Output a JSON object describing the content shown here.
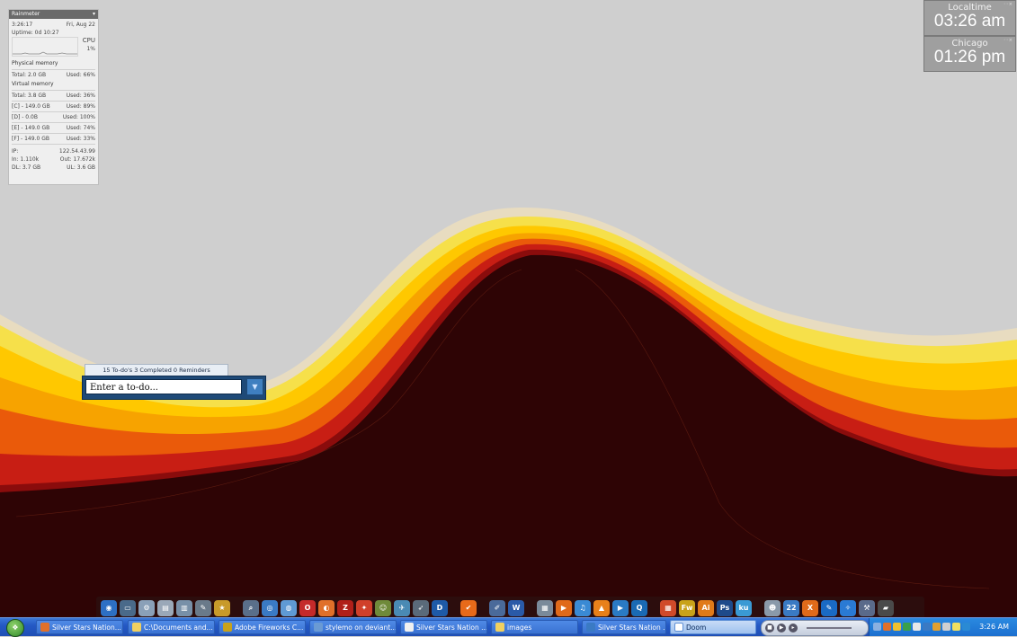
{
  "rainmeter": {
    "title": "Rainmeter",
    "time": "3:26:17",
    "date": "Fri, Aug 22",
    "uptime": "Uptime: 0d 10:27",
    "cpu_label": "CPU",
    "cpu_value": "1%",
    "physical_memory_label": "Physical memory",
    "physical_total": "Total: 2.0 GB",
    "physical_used": "Used: 66%",
    "virtual_memory_label": "Virtual memory",
    "virtual_total": "Total: 3.8 GB",
    "virtual_used": "Used: 36%",
    "drives": [
      {
        "label": "[C] - 149.0 GB",
        "used": "Used: 89%"
      },
      {
        "label": "[D] - 0.0B",
        "used": "Used: 100%"
      },
      {
        "label": "[E] - 149.0 GB",
        "used": "Used: 74%"
      },
      {
        "label": "[F] - 149.0 GB",
        "used": "Used: 33%"
      }
    ],
    "ip_label": "IP:",
    "ip_value": "122.54.43.99",
    "in_value": "In: 1.110k",
    "out_value": "Out: 17.672k",
    "dl_value": "DL: 3.7 GB",
    "ul_value": "UL: 3.6 GB"
  },
  "clocks": [
    {
      "city": "Localtime",
      "time": "03:26 am"
    },
    {
      "city": "Chicago",
      "time": "01:26 pm"
    }
  ],
  "todo": {
    "summary": "15 To-do's 3 Completed 0 Reminders",
    "placeholder": "Enter a to-do..."
  },
  "dock": {
    "icons": [
      {
        "name": "system-icon",
        "color": "#2d6fc4",
        "glyph": "◉"
      },
      {
        "name": "monitor-icon",
        "color": "#4a6a8a",
        "glyph": "▭"
      },
      {
        "name": "tools-icon",
        "color": "#8aa0b8",
        "glyph": "⚙"
      },
      {
        "name": "documents-icon",
        "color": "#9aa8b8",
        "glyph": "▤"
      },
      {
        "name": "folder-icon",
        "color": "#7890a8",
        "glyph": "▥"
      },
      {
        "name": "pen-icon",
        "color": "#6a7a8a",
        "glyph": "✎"
      },
      {
        "name": "star-icon",
        "color": "#c89a2a",
        "glyph": "★"
      },
      {
        "name": "search-icon",
        "color": "#5a6f8a",
        "glyph": "⌕"
      },
      {
        "name": "browser-icon",
        "color": "#3a7ac4",
        "glyph": "◎"
      },
      {
        "name": "globe-icon",
        "color": "#5f9ad4",
        "glyph": "◍"
      },
      {
        "name": "opera-icon",
        "color": "#c42a2a",
        "glyph": "O"
      },
      {
        "name": "firefox-icon",
        "color": "#e0702a",
        "glyph": "◐"
      },
      {
        "name": "filezilla-icon",
        "color": "#b0201a",
        "glyph": "Z"
      },
      {
        "name": "game-icon",
        "color": "#d0402a",
        "glyph": "✦"
      },
      {
        "name": "mascot-icon",
        "color": "#6f8a3a",
        "glyph": "☺"
      },
      {
        "name": "bird-icon",
        "color": "#4a8ab4",
        "glyph": "✈"
      },
      {
        "name": "wing-icon",
        "color": "#5a6a7a",
        "glyph": "➶"
      },
      {
        "name": "d-app-icon",
        "color": "#1e5aa8",
        "glyph": "D"
      },
      {
        "name": "check-icon",
        "color": "#e86a1a",
        "glyph": "✔"
      },
      {
        "name": "pencil-ruler-icon",
        "color": "#4a6a9a",
        "glyph": "✐"
      },
      {
        "name": "word-icon",
        "color": "#2a5aa8",
        "glyph": "W"
      },
      {
        "name": "book-icon",
        "color": "#7a8a9a",
        "glyph": "▦"
      },
      {
        "name": "media-icon",
        "color": "#e06a1a",
        "glyph": "▶"
      },
      {
        "name": "itunes-icon",
        "color": "#3a8ad4",
        "glyph": "♫"
      },
      {
        "name": "vlc-icon",
        "color": "#e8801a",
        "glyph": "▲"
      },
      {
        "name": "play-icon",
        "color": "#2a7ac4",
        "glyph": "▶"
      },
      {
        "name": "quicktime-icon",
        "color": "#1a6ab4",
        "glyph": "Q"
      },
      {
        "name": "office-icon",
        "color": "#d04a2a",
        "glyph": "▦"
      },
      {
        "name": "fireworks-icon",
        "color": "#c8a21a",
        "glyph": "Fw"
      },
      {
        "name": "illustrator-icon",
        "color": "#e07a1a",
        "glyph": "Ai"
      },
      {
        "name": "photoshop-icon",
        "color": "#1e4a8a",
        "glyph": "Ps"
      },
      {
        "name": "kuler-icon",
        "color": "#3a9ad4",
        "glyph": "ku"
      },
      {
        "name": "alien-icon",
        "color": "#8a9aaa",
        "glyph": "☻"
      },
      {
        "name": "calendar-icon",
        "color": "#3a7ac4",
        "glyph": "22"
      },
      {
        "name": "xampp-icon",
        "color": "#e06a1a",
        "glyph": "X"
      },
      {
        "name": "wrench-icon",
        "color": "#1a6ac4",
        "glyph": "✎"
      },
      {
        "name": "settings-icon",
        "color": "#2a7ad4",
        "glyph": "✧"
      },
      {
        "name": "tools2-icon",
        "color": "#5a6a8a",
        "glyph": "⚒"
      },
      {
        "name": "drive-icon",
        "color": "#4a4a4a",
        "glyph": "▰"
      }
    ]
  },
  "taskbar": {
    "tasks": [
      {
        "label": "Silver Stars Nation...",
        "color": "#e0702a"
      },
      {
        "label": "C:\\Documents and...",
        "color": "#f0d060"
      },
      {
        "label": "Adobe Fireworks C...",
        "color": "#c8a21a"
      },
      {
        "label": "stylemo on deviant...",
        "color": "#6a9ad4"
      },
      {
        "label": "Silver Stars Nation ...",
        "color": "#f0f0f0"
      },
      {
        "label": "images",
        "color": "#f0d060"
      },
      {
        "label": "Silver Stars Nation ...",
        "color": "#3a7ac4"
      },
      {
        "label": "Doom",
        "color": "#ffffff"
      }
    ],
    "clock": "3:26 AM"
  }
}
